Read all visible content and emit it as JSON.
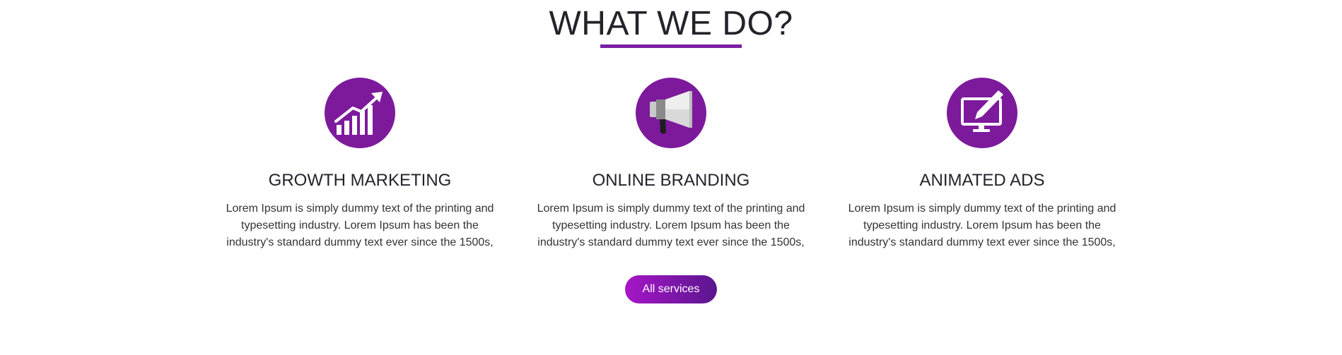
{
  "section": {
    "title": "WHAT WE DO?",
    "accent_color": "#7b1fa2"
  },
  "services": [
    {
      "icon": "growth-chart-icon",
      "title": "GROWTH MARKETING",
      "text": "Lorem Ipsum is simply dummy text of the printing and typesetting industry. Lorem Ipsum has been the industry's standard dummy text ever since the 1500s,"
    },
    {
      "icon": "megaphone-icon",
      "title": "ONLINE BRANDING",
      "text": "Lorem Ipsum is simply dummy text of the printing and typesetting industry. Lorem Ipsum has been the industry's standard dummy text ever since the 1500s,"
    },
    {
      "icon": "monitor-pen-icon",
      "title": "ANIMATED ADS",
      "text": "Lorem Ipsum is simply dummy text of the printing and typesetting industry. Lorem Ipsum has been the industry's standard dummy text ever since the 1500s,"
    }
  ],
  "cta": {
    "label": "All services"
  }
}
